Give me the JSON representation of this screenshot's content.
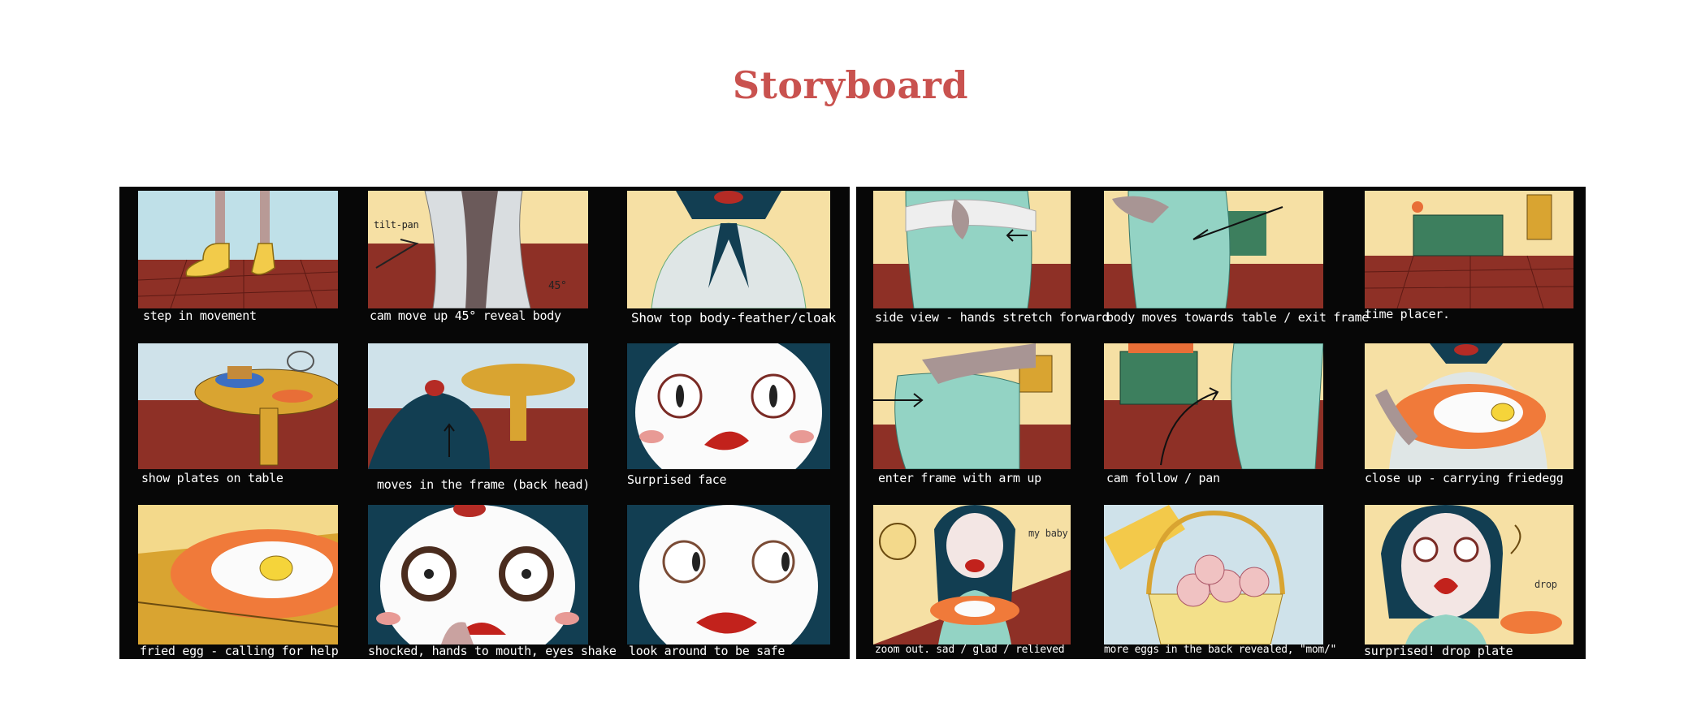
{
  "page": {
    "title": "Storyboard"
  },
  "sheets": {
    "left": {
      "captions": [
        "step in movement",
        "cam move up 45°  reveal body",
        "Show top body-feather/cloak",
        "show plates on table",
        "moves in the frame (back head)",
        "Surprised face",
        "fried egg - calling for help",
        "shocked, hands to mouth, eyes shake",
        "look around to be safe"
      ],
      "annotations": {
        "tilt": "tilt-pan",
        "angle": "45°"
      }
    },
    "right": {
      "captions": [
        "side view - hands stretch forward",
        "body moves towards table / exit frame",
        "time placer.",
        "enter frame  with arm up",
        "cam follow / pan",
        "close up - carrying friedegg",
        "zoom out. sad / glad / relieved",
        "more eggs in the back revealed, \"mom/\"",
        "surprised! drop plate"
      ],
      "annotations": {
        "baby": "my baby",
        "drop": "drop"
      }
    }
  },
  "colors": {
    "title": "#c9524f",
    "frame": "#070707",
    "floor": "#8e3026",
    "sky": "#b9dde6",
    "wall": "#f6e0a4",
    "teal": "#123e52",
    "dress": "#93d3c4"
  }
}
